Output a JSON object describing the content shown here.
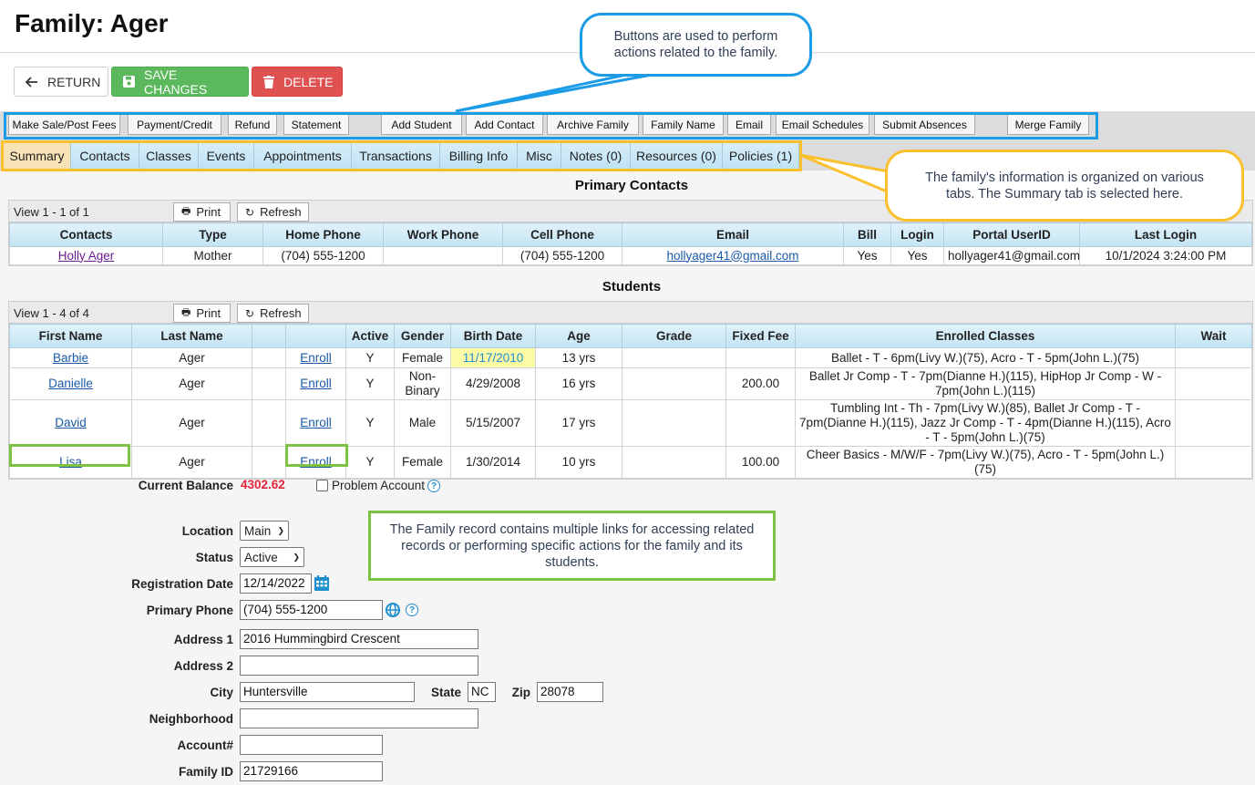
{
  "header": {
    "title": "Family: Ager"
  },
  "actions": {
    "return_label": "RETURN",
    "save_label": "SAVE CHANGES",
    "delete_label": "DELETE"
  },
  "toolbar": {
    "buttons": [
      "Make Sale/Post Fees",
      "Payment/Credit",
      "Refund",
      "Statement",
      "Add Student",
      "Add Contact",
      "Archive Family",
      "Family Name",
      "Email",
      "Email Schedules",
      "Submit Absences",
      "Merge Family"
    ]
  },
  "tabs": {
    "items": [
      "Summary",
      "Contacts",
      "Classes",
      "Events",
      "Appointments",
      "Transactions",
      "Billing Info",
      "Misc",
      "Notes (0)",
      "Resources (0)",
      "Policies (1)"
    ],
    "active": "Summary"
  },
  "primary_contacts": {
    "title": "Primary Contacts",
    "view_label": "View 1 - 1 of 1",
    "print_label": "Print",
    "refresh_label": "Refresh",
    "columns": [
      "Contacts",
      "Type",
      "Home Phone",
      "Work Phone",
      "Cell Phone",
      "Email",
      "Bill",
      "Login",
      "Portal UserID",
      "Last Login"
    ],
    "rows": [
      [
        "Holly Ager",
        "Mother",
        "(704) 555-1200",
        "",
        "(704) 555-1200",
        "hollyager41@gmail.com",
        "Yes",
        "Yes",
        "hollyager41@gmail.com",
        "10/1/2024 3:24:00 PM"
      ]
    ]
  },
  "students": {
    "title": "Students",
    "view_label": "View 1 - 4 of 4",
    "print_label": "Print",
    "refresh_label": "Refresh",
    "columns": [
      "First Name",
      "Last Name",
      "",
      "",
      "Active",
      "Gender",
      "Birth Date",
      "Age",
      "Grade",
      "Fixed Fee",
      "Enrolled Classes",
      "Wait"
    ],
    "rows": [
      [
        "Barbie",
        "Ager",
        "",
        "Enroll",
        "Y",
        "Female",
        "11/17/2010",
        "13 yrs",
        "",
        "",
        "Ballet - T - 6pm(Livy W.)(75), Acro - T - 5pm(John L.)(75)",
        ""
      ],
      [
        "Danielle",
        "Ager",
        "",
        "Enroll",
        "Y",
        "Non-Binary",
        "4/29/2008",
        "16 yrs",
        "",
        "200.00",
        "Ballet Jr Comp - T - 7pm(Dianne H.)(115), HipHop Jr Comp - W - 7pm(John L.)(115)",
        ""
      ],
      [
        "David",
        "Ager",
        "",
        "Enroll",
        "Y",
        "Male",
        "5/15/2007",
        "17 yrs",
        "",
        "",
        "Tumbling Int - Th - 7pm(Livy W.)(85), Ballet Jr Comp - T - 7pm(Dianne H.)(115), Jazz Jr Comp - T - 4pm(Dianne H.)(115), Acro - T - 5pm(John L.)(75)",
        ""
      ],
      [
        "Lisa",
        "Ager",
        "",
        "Enroll",
        "Y",
        "Female",
        "1/30/2014",
        "10 yrs",
        "",
        "100.00",
        "Cheer Basics - M/W/F - 7pm(Livy W.)(75), Acro - T - 5pm(John L.)(75)",
        ""
      ]
    ]
  },
  "form": {
    "current_balance_label": "Current Balance",
    "current_balance": "4302.62",
    "problem_account_label": "Problem Account",
    "problem_account_checked": false,
    "location_label": "Location",
    "location_value": "Main",
    "status_label": "Status",
    "status_value": "Active",
    "registration_date_label": "Registration Date",
    "registration_date": "12/14/2022",
    "primary_phone_label": "Primary Phone",
    "primary_phone": "(704) 555-1200",
    "address1_label": "Address 1",
    "address1": "2016 Hummingbird Crescent",
    "address2_label": "Address 2",
    "address2": "",
    "city_label": "City",
    "city": "Huntersville",
    "state_label": "State",
    "state": "NC",
    "zip_label": "Zip",
    "zip": "28078",
    "neighborhood_label": "Neighborhood",
    "neighborhood": "",
    "account_label": "Account#",
    "account": "",
    "family_id_label": "Family ID",
    "family_id": "21729166"
  },
  "callouts": {
    "buttons": "Buttons are used to perform actions related to the family.",
    "tabs": "The family's information is organized on various tabs. The Summary tab is selected here.",
    "links": "The Family record contains multiple links for accessing related records or performing specific actions for the family and its students."
  },
  "colors": {
    "save": "#5cb85c",
    "delete": "#e05252",
    "balance": "#e0243c",
    "callout_blue": "#1c9be6",
    "callout_gold": "#fbc02d",
    "callout_green": "#7dc242",
    "link": "#1a5aa8"
  }
}
